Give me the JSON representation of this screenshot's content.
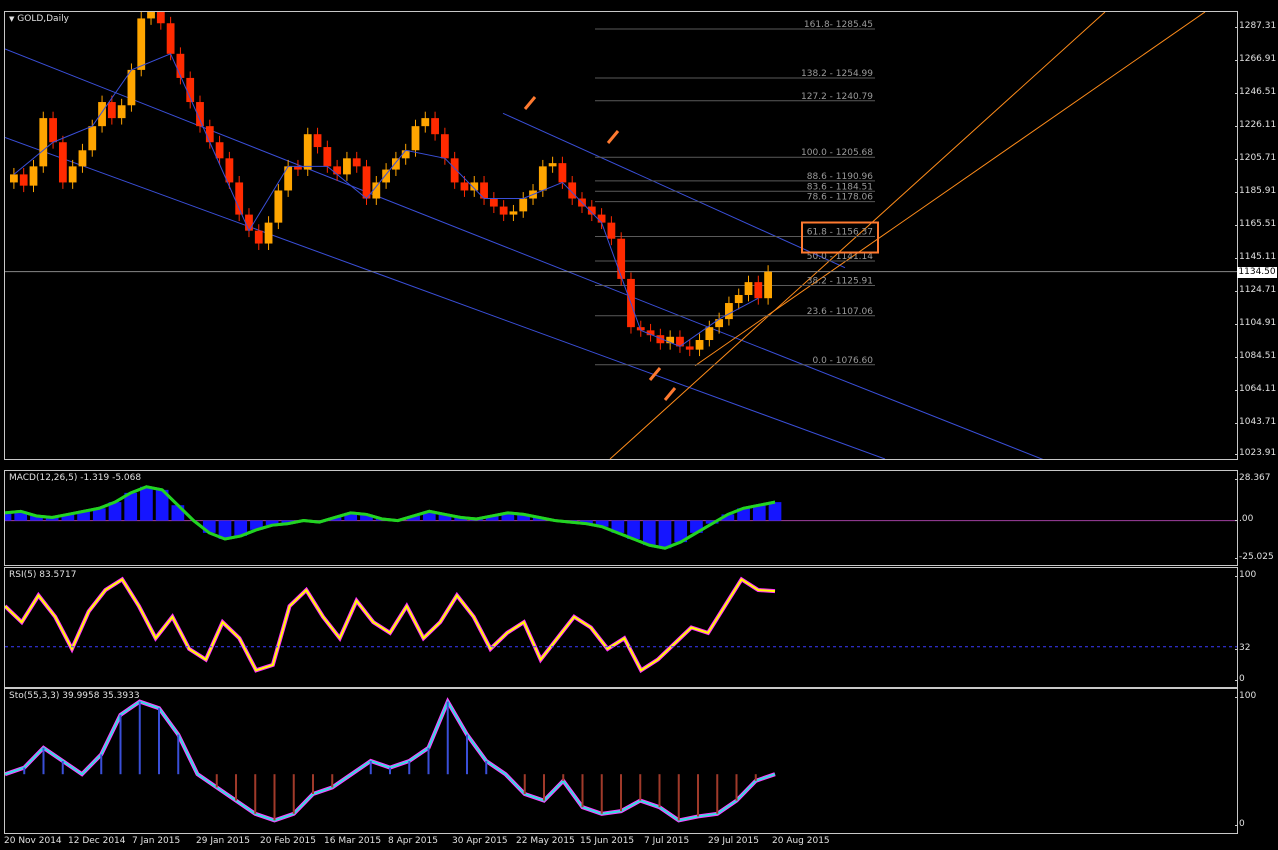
{
  "chart_title": "GOLD,Daily",
  "indicators": {
    "macd": "MACD(12,26,5) -1.319 -5.068",
    "rsi": "RSI(5) 83.5717",
    "sto": "Sto(55,3,3) 39.9958 35.3933"
  },
  "price_axis": [
    "1287.31",
    "1266.91",
    "1246.51",
    "1226.11",
    "1205.71",
    "1185.91",
    "1165.51",
    "1145.11",
    "1124.71",
    "1104.91",
    "1084.51",
    "1064.11",
    "1043.71",
    "1023.91"
  ],
  "current_price": "1134.50",
  "macd_axis": [
    "28.367",
    ".00",
    "-25.025"
  ],
  "rsi_axis": [
    "100",
    "32",
    "0"
  ],
  "sto_axis": [
    "100",
    "0"
  ],
  "time_axis": [
    "20 Nov 2014",
    "12 Dec 2014",
    "7 Jan 2015",
    "29 Jan 2015",
    "20 Feb 2015",
    "16 Mar 2015",
    "8 Apr 2015",
    "30 Apr 2015",
    "22 May 2015",
    "15 Jun 2015",
    "7 Jul 2015",
    "29 Jul 2015",
    "20 Aug 2015"
  ],
  "fib_labels": [
    "161.8- 1285.45",
    "138.2 - 1254.99",
    "127.2 - 1240.79",
    "100.0 - 1205.68",
    "88.6 - 1190.96",
    "83.6 - 1184.51",
    "78.6 - 1178.06",
    "61.8 - 1156.37",
    "50.0 - 1141.14",
    "38.2 - 1125.91",
    "23.6 - 1107.06",
    "0.0 - 1076.60"
  ],
  "colors": {
    "bull": "#ffa500",
    "bear": "#ff2a00",
    "trend": "#3a4fd8",
    "channel": "#ff8c1a",
    "macd_line": "#22d322",
    "macd_hist": "#1515ff",
    "rsi_line": "#ffff00",
    "rsi_shadow": "#ff30ff",
    "sto_main": "#30e0e0",
    "sto_signal": "#ff40ff",
    "highlight": "#ff7a30"
  },
  "chart_data": {
    "type": "candlestick",
    "title": "GOLD,Daily",
    "instrument": "GOLD",
    "timeframe": "Daily",
    "x": [
      "20 Nov 2014",
      "12 Dec 2014",
      "7 Jan 2015",
      "29 Jan 2015",
      "20 Feb 2015",
      "16 Mar 2015",
      "8 Apr 2015",
      "30 Apr 2015",
      "22 May 2015",
      "15 Jun 2015",
      "7 Jul 2015",
      "29 Jul 2015",
      "20 Aug 2015"
    ],
    "close_path": [
      1195,
      1188,
      1200,
      1230,
      1215,
      1190,
      1200,
      1210,
      1225,
      1240,
      1230,
      1238,
      1260,
      1292,
      1296,
      1289,
      1270,
      1255,
      1240,
      1225,
      1215,
      1205,
      1190,
      1170,
      1160,
      1152,
      1165,
      1185,
      1200,
      1198,
      1220,
      1212,
      1200,
      1195,
      1205,
      1200,
      1180,
      1190,
      1198,
      1205,
      1210,
      1225,
      1230,
      1220,
      1205,
      1190,
      1185,
      1190,
      1180,
      1175,
      1170,
      1172,
      1180,
      1185,
      1200,
      1202,
      1190,
      1180,
      1175,
      1170,
      1165,
      1155,
      1130,
      1100,
      1098,
      1095,
      1090,
      1094,
      1088,
      1086,
      1092,
      1100,
      1105,
      1115,
      1120,
      1128,
      1118,
      1134.5
    ],
    "ylim": [
      1018,
      1296
    ],
    "current_price": 1134.5,
    "fibonacci": [
      {
        "level": 161.8,
        "price": 1285.45
      },
      {
        "level": 138.2,
        "price": 1254.99
      },
      {
        "level": 127.2,
        "price": 1240.79
      },
      {
        "level": 100.0,
        "price": 1205.68
      },
      {
        "level": 88.6,
        "price": 1190.96
      },
      {
        "level": 83.6,
        "price": 1184.51
      },
      {
        "level": 78.6,
        "price": 1178.06
      },
      {
        "level": 61.8,
        "price": 1156.37
      },
      {
        "level": 50.0,
        "price": 1141.14
      },
      {
        "level": 38.2,
        "price": 1125.91
      },
      {
        "level": 23.6,
        "price": 1107.06
      },
      {
        "level": 0.0,
        "price": 1076.6
      }
    ],
    "highlighted_level": 61.8,
    "macd": {
      "params": "12,26,5",
      "main": -1.319,
      "signal": -5.068,
      "ylim": [
        -25.025,
        28.367
      ],
      "line": [
        5,
        6,
        3,
        2,
        4,
        6,
        8,
        12,
        18,
        22,
        20,
        10,
        0,
        -8,
        -12,
        -10,
        -6,
        -3,
        -2,
        0,
        -1,
        2,
        5,
        4,
        1,
        0,
        3,
        6,
        4,
        2,
        1,
        3,
        5,
        4,
        2,
        0,
        -1,
        -2,
        -4,
        -8,
        -12,
        -16,
        -18,
        -14,
        -8,
        -2,
        4,
        8,
        10,
        12
      ]
    },
    "rsi": {
      "period": 5,
      "value": 83.5717,
      "levels": [
        32
      ],
      "line": [
        70,
        55,
        80,
        60,
        30,
        65,
        85,
        95,
        70,
        40,
        60,
        30,
        20,
        55,
        40,
        10,
        15,
        70,
        85,
        60,
        40,
        75,
        55,
        45,
        70,
        40,
        55,
        80,
        60,
        30,
        45,
        55,
        20,
        40,
        60,
        50,
        30,
        40,
        10,
        20,
        35,
        50,
        45,
        70,
        95,
        85,
        84
      ]
    },
    "stochastic": {
      "params": "55,3,3",
      "main": 39.9958,
      "signal": 35.3933,
      "line": [
        40,
        45,
        60,
        50,
        40,
        55,
        85,
        95,
        90,
        70,
        40,
        30,
        20,
        10,
        5,
        10,
        25,
        30,
        40,
        50,
        45,
        50,
        60,
        95,
        70,
        50,
        40,
        25,
        20,
        35,
        15,
        10,
        12,
        20,
        15,
        5,
        8,
        10,
        20,
        35,
        40
      ]
    }
  }
}
